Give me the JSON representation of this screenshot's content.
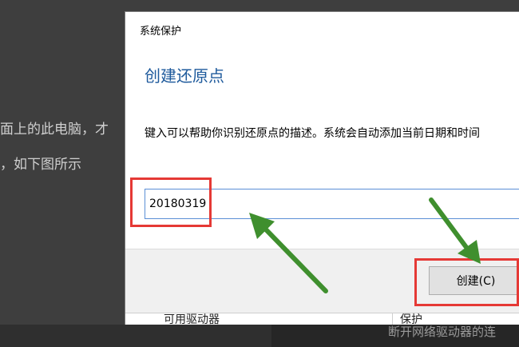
{
  "background": {
    "line1": "面上的此电脑，才",
    "line2": "，如下图所示",
    "bottom_text": "断开网络驱动器的连"
  },
  "dialog": {
    "title": "系统保护",
    "heading": "创建还原点",
    "description": "键入可以帮助你识别还原点的描述。系统会自动添加当前日期和时间",
    "input_value": "20180319",
    "create_button": "创建(C)",
    "under_left": "可用驱动器",
    "under_right": "保护"
  },
  "colors": {
    "heading": "#1e5a9c",
    "highlight": "#e53935",
    "arrow": "#3f8f2e"
  }
}
